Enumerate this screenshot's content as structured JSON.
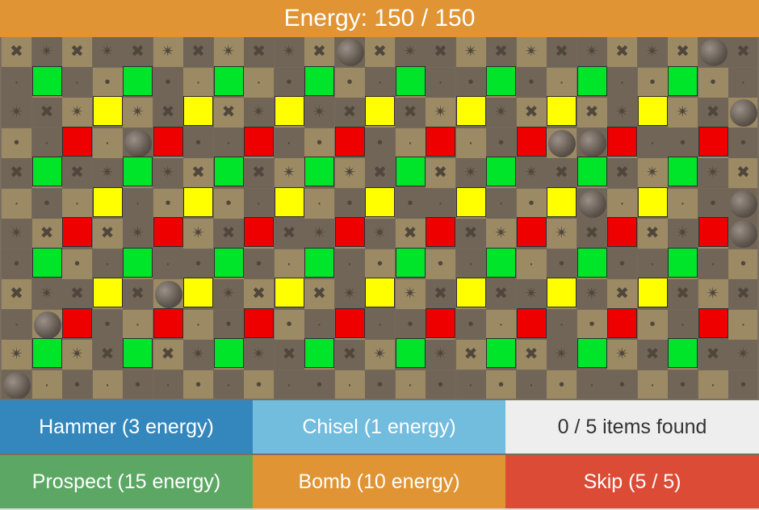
{
  "energy": {
    "label": "Energy: 150 / 150"
  },
  "board": {
    "cols": 25,
    "rows": 12,
    "rocks": [
      [
        11,
        0
      ],
      [
        23,
        0
      ],
      [
        24,
        2
      ],
      [
        4,
        3
      ],
      [
        18,
        3
      ],
      [
        19,
        3
      ],
      [
        24,
        5
      ],
      [
        19,
        5
      ],
      [
        24,
        6
      ],
      [
        5,
        8
      ],
      [
        1,
        9
      ],
      [
        0,
        11
      ]
    ],
    "cells": [
      {
        "r": 1,
        "c": 1,
        "t": "green"
      },
      {
        "r": 1,
        "c": 4,
        "t": "green"
      },
      {
        "r": 1,
        "c": 7,
        "t": "green"
      },
      {
        "r": 1,
        "c": 10,
        "t": "green"
      },
      {
        "r": 1,
        "c": 13,
        "t": "green"
      },
      {
        "r": 1,
        "c": 16,
        "t": "green"
      },
      {
        "r": 1,
        "c": 19,
        "t": "green"
      },
      {
        "r": 1,
        "c": 22,
        "t": "green"
      },
      {
        "r": 2,
        "c": 3,
        "t": "yellow"
      },
      {
        "r": 2,
        "c": 6,
        "t": "yellow"
      },
      {
        "r": 2,
        "c": 9,
        "t": "yellow"
      },
      {
        "r": 2,
        "c": 12,
        "t": "yellow"
      },
      {
        "r": 2,
        "c": 15,
        "t": "yellow"
      },
      {
        "r": 2,
        "c": 18,
        "t": "yellow"
      },
      {
        "r": 2,
        "c": 21,
        "t": "yellow"
      },
      {
        "r": 3,
        "c": 2,
        "t": "red"
      },
      {
        "r": 3,
        "c": 5,
        "t": "red"
      },
      {
        "r": 3,
        "c": 8,
        "t": "red"
      },
      {
        "r": 3,
        "c": 11,
        "t": "red"
      },
      {
        "r": 3,
        "c": 14,
        "t": "red"
      },
      {
        "r": 3,
        "c": 17,
        "t": "red"
      },
      {
        "r": 3,
        "c": 20,
        "t": "red"
      },
      {
        "r": 3,
        "c": 23,
        "t": "red"
      },
      {
        "r": 4,
        "c": 1,
        "t": "green"
      },
      {
        "r": 4,
        "c": 4,
        "t": "green"
      },
      {
        "r": 4,
        "c": 7,
        "t": "green"
      },
      {
        "r": 4,
        "c": 10,
        "t": "green"
      },
      {
        "r": 4,
        "c": 13,
        "t": "green"
      },
      {
        "r": 4,
        "c": 16,
        "t": "green"
      },
      {
        "r": 4,
        "c": 19,
        "t": "green"
      },
      {
        "r": 4,
        "c": 22,
        "t": "green"
      },
      {
        "r": 5,
        "c": 3,
        "t": "yellow"
      },
      {
        "r": 5,
        "c": 6,
        "t": "yellow"
      },
      {
        "r": 5,
        "c": 9,
        "t": "yellow"
      },
      {
        "r": 5,
        "c": 12,
        "t": "yellow"
      },
      {
        "r": 5,
        "c": 15,
        "t": "yellow"
      },
      {
        "r": 5,
        "c": 18,
        "t": "yellow"
      },
      {
        "r": 5,
        "c": 21,
        "t": "yellow"
      },
      {
        "r": 6,
        "c": 2,
        "t": "red"
      },
      {
        "r": 6,
        "c": 5,
        "t": "red"
      },
      {
        "r": 6,
        "c": 8,
        "t": "red"
      },
      {
        "r": 6,
        "c": 11,
        "t": "red"
      },
      {
        "r": 6,
        "c": 14,
        "t": "red"
      },
      {
        "r": 6,
        "c": 17,
        "t": "red"
      },
      {
        "r": 6,
        "c": 20,
        "t": "red"
      },
      {
        "r": 6,
        "c": 23,
        "t": "red"
      },
      {
        "r": 7,
        "c": 1,
        "t": "green"
      },
      {
        "r": 7,
        "c": 4,
        "t": "green"
      },
      {
        "r": 7,
        "c": 7,
        "t": "green"
      },
      {
        "r": 7,
        "c": 10,
        "t": "green"
      },
      {
        "r": 7,
        "c": 13,
        "t": "green"
      },
      {
        "r": 7,
        "c": 16,
        "t": "green"
      },
      {
        "r": 7,
        "c": 19,
        "t": "green"
      },
      {
        "r": 7,
        "c": 22,
        "t": "green"
      },
      {
        "r": 8,
        "c": 3,
        "t": "yellow"
      },
      {
        "r": 8,
        "c": 6,
        "t": "yellow"
      },
      {
        "r": 8,
        "c": 9,
        "t": "yellow"
      },
      {
        "r": 8,
        "c": 12,
        "t": "yellow"
      },
      {
        "r": 8,
        "c": 15,
        "t": "yellow"
      },
      {
        "r": 8,
        "c": 18,
        "t": "yellow"
      },
      {
        "r": 8,
        "c": 21,
        "t": "yellow"
      },
      {
        "r": 9,
        "c": 2,
        "t": "red"
      },
      {
        "r": 9,
        "c": 5,
        "t": "red"
      },
      {
        "r": 9,
        "c": 8,
        "t": "red"
      },
      {
        "r": 9,
        "c": 11,
        "t": "red"
      },
      {
        "r": 9,
        "c": 14,
        "t": "red"
      },
      {
        "r": 9,
        "c": 17,
        "t": "red"
      },
      {
        "r": 9,
        "c": 20,
        "t": "red"
      },
      {
        "r": 9,
        "c": 23,
        "t": "red"
      },
      {
        "r": 10,
        "c": 1,
        "t": "green"
      },
      {
        "r": 10,
        "c": 4,
        "t": "green"
      },
      {
        "r": 10,
        "c": 7,
        "t": "green"
      },
      {
        "r": 10,
        "c": 10,
        "t": "green"
      },
      {
        "r": 10,
        "c": 13,
        "t": "green"
      },
      {
        "r": 10,
        "c": 16,
        "t": "green"
      },
      {
        "r": 10,
        "c": 19,
        "t": "green"
      },
      {
        "r": 10,
        "c": 22,
        "t": "green"
      }
    ]
  },
  "toolbar": {
    "hammer": {
      "label": "Hammer (3 energy)",
      "color": "#3487bd"
    },
    "chisel": {
      "label": "Chisel (1 energy)",
      "color": "#72bcde"
    },
    "items_found": {
      "label": "0 / 5 items found",
      "color": "#eeeeee"
    },
    "prospect": {
      "label": "Prospect (15 energy)",
      "color": "#5ca764"
    },
    "bomb": {
      "label": "Bomb (10 energy)",
      "color": "#e09433"
    },
    "skip": {
      "label": "Skip (5 / 5)",
      "color": "#dc4b36"
    }
  }
}
